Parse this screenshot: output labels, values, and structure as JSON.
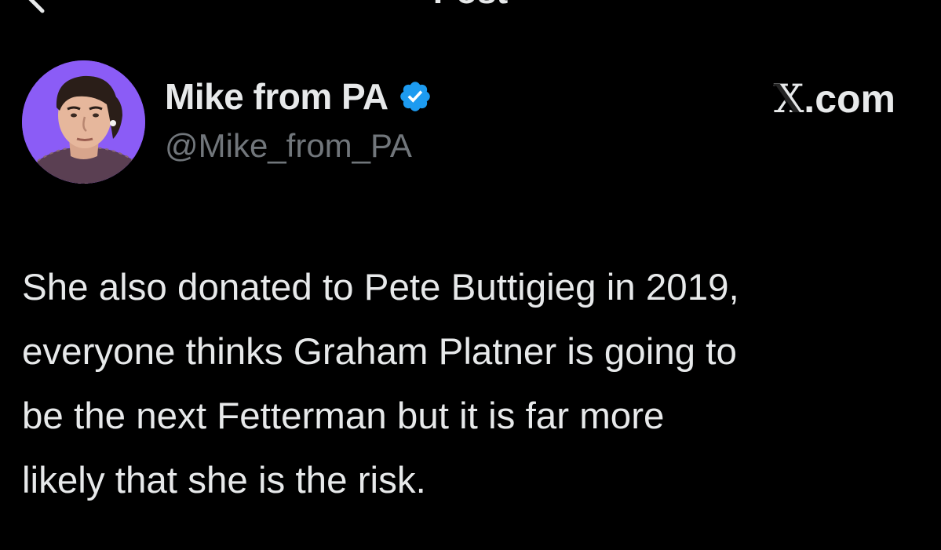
{
  "header": {
    "title": "Post",
    "back_icon": "back-arrow-icon"
  },
  "author": {
    "display_name": "Mike from PA",
    "handle": "@Mike_from_PA",
    "verified": true,
    "verified_icon": "verified-badge-icon",
    "avatar_background": "#8b5cf6"
  },
  "brand": {
    "label": "X.com",
    "logo_letter": "X",
    "logo_suffix": ".com"
  },
  "post": {
    "text": "She also donated to Pete Buttigieg in 2019,\neveryone thinks Graham Platner is going to\nbe the next Fetterman but it is far more\nlikely that she is the risk."
  },
  "colors": {
    "background": "#000000",
    "text_primary": "#e7e9ea",
    "text_secondary": "#71767b",
    "verified_blue": "#1d9bf0"
  }
}
